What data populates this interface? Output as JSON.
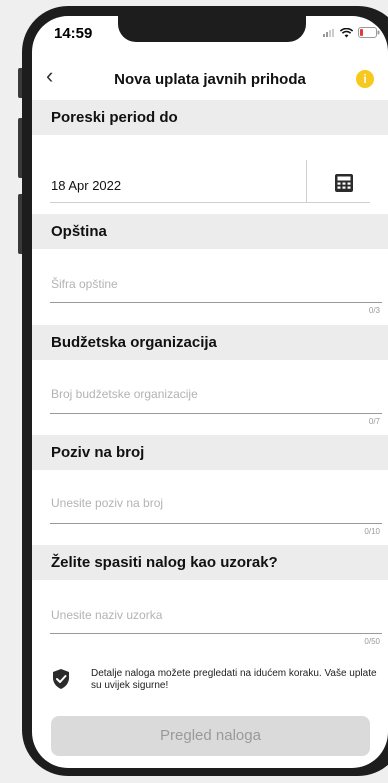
{
  "status": {
    "time": "14:59"
  },
  "nav": {
    "title": "Nova uplata javnih prihoda",
    "back_icon": "‹",
    "info_icon": "i"
  },
  "sections": {
    "period": "Poreski period do",
    "opstina": "Opština",
    "budzet": "Budžetska organizacija",
    "poziv": "Poziv na broj",
    "uzorak": "Želite spasiti nalog kao uzorak?"
  },
  "date": {
    "value": "18 Apr 2022"
  },
  "fields": {
    "opstina": {
      "placeholder": "Šifra opštine",
      "counter": "0/3"
    },
    "budzet": {
      "placeholder": "Broj budžetske organizacije",
      "counter": "0/7"
    },
    "poziv": {
      "placeholder": "Unesite poziv na broj",
      "counter": "0/10"
    },
    "uzorak": {
      "placeholder": "Unesite naziv uzorka",
      "counter": "0/50"
    }
  },
  "notice": {
    "text": "Detalje naloga možete pregledati na idućem koraku. Vaše uplate su uvijek sigurne!"
  },
  "cta": {
    "label": "Pregled naloga"
  },
  "colors": {
    "accent": "#f7c81e",
    "section_bg": "#ececec",
    "button_disabled": "#dadada"
  }
}
